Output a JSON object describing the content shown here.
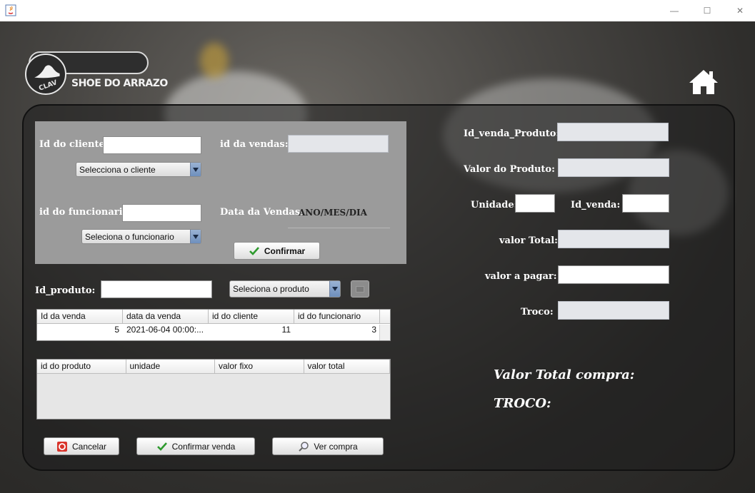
{
  "window": {
    "minimize_glyph": "—",
    "maximize_glyph": "☐",
    "close_glyph": "✕"
  },
  "brand": {
    "logo_mark": "CLAV",
    "name": "SHOE DO ARRAZO"
  },
  "cliente": {
    "label": "Id do cliente:",
    "value": "",
    "combo": "Selecciona o cliente"
  },
  "vendas": {
    "label": "id da vendas:",
    "value": ""
  },
  "funcionario": {
    "label": "id do funcionario:",
    "value": "",
    "combo": "Seleciona o funcionario"
  },
  "data_venda": {
    "label": "Data da Vendas:",
    "value": "ANO/MES/DIA"
  },
  "confirmar_label": "Confirmar",
  "produto": {
    "label": "Id_produto:",
    "value": "",
    "combo": "Seleciona o produto"
  },
  "vendas_table": {
    "columns": [
      "Id da venda",
      "data da venda",
      "id do cliente",
      "id do funcionario"
    ],
    "rows": [
      [
        "5",
        "2021-06-04 00:00:...",
        "11",
        "3"
      ]
    ]
  },
  "produtos_table": {
    "columns": [
      "id do produto",
      "unidade",
      "valor fixo",
      "valor total"
    ],
    "rows": []
  },
  "buttons": {
    "cancelar": "Cancelar",
    "confirmar_venda": "Confirmar venda",
    "ver_compra": "Ver compra"
  },
  "right": {
    "id_venda_produto_label": "Id_venda_Produto:",
    "valor_produto_label": "Valor do Produto:",
    "unidade_label": "Unidade:",
    "id_venda_label": "Id_venda:",
    "valor_total_label": "valor Total:",
    "valor_pagar_label": "valor a pagar:",
    "troco_label": "Troco:",
    "valor_total_compra": "Valor Total compra:",
    "troco_total": "TROCO:"
  },
  "colors": {
    "accent_arrow": "#6e8fbd",
    "panel_gray": "#9b9b9b",
    "check_green": "#2e9a2e",
    "cancel_red": "#d9342b"
  }
}
